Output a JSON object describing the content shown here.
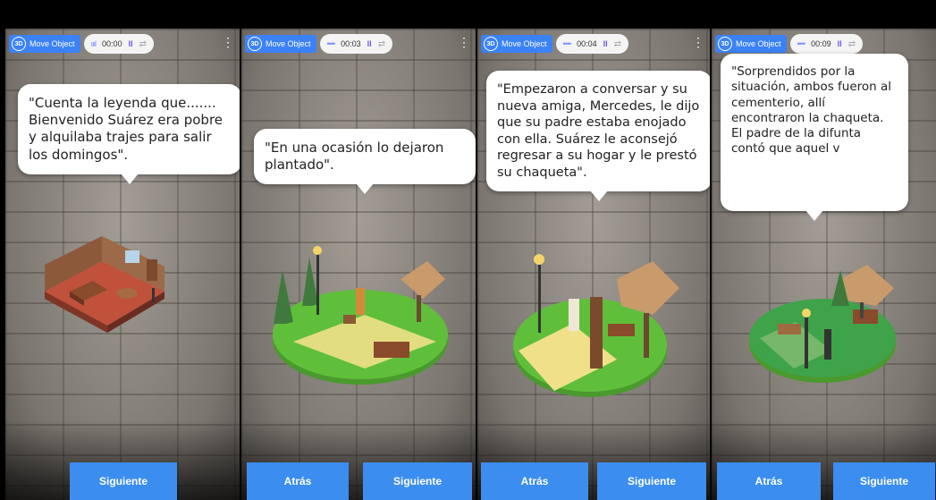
{
  "toolbar": {
    "move_object_label": "Move Object",
    "icon_3d_text": "3D",
    "menu_glyph": "⋮",
    "pause_glyph": "II",
    "loop_glyph": "⇄"
  },
  "panels": [
    {
      "timer": "00:00",
      "bars": "ıııl",
      "bubble_text": "\"Cuenta la leyenda que....... Bienvenido Suárez era pobre y alquilaba trajes para salir los domingos\".",
      "buttons": [
        {
          "label": "Siguiente"
        }
      ]
    },
    {
      "timer": "00:03",
      "bars": "••••",
      "bubble_text": "\"En una ocasión lo dejaron plantado\".",
      "buttons": [
        {
          "label": "Atrás"
        },
        {
          "label": "Siguiente"
        }
      ]
    },
    {
      "timer": "00:04",
      "bars": "••••",
      "bubble_text": "\"Empezaron a conversar y su nueva amiga, Mercedes, le dijo que su padre estaba enojado con ella. Suárez le aconsejó regresar a su hogar y le prestó su chaqueta\".",
      "buttons": [
        {
          "label": "Atrás"
        },
        {
          "label": "Siguiente"
        }
      ]
    },
    {
      "timer": "00:09",
      "bars": "••••",
      "bubble_text": "\"Sorprendidos por la situación, ambos fueron al cementerio, allí encontraron la chaqueta. El padre de la difunta contó que aquel v",
      "buttons": [
        {
          "label": "Atrás"
        },
        {
          "label": "Siguiente"
        }
      ]
    }
  ],
  "colors": {
    "button_blue": "#3b8df0",
    "move_object_blue": "#3b82f6",
    "bubble_bg": "#ffffff",
    "grass": "#5fbf3a",
    "floor_red": "#c0513a"
  }
}
